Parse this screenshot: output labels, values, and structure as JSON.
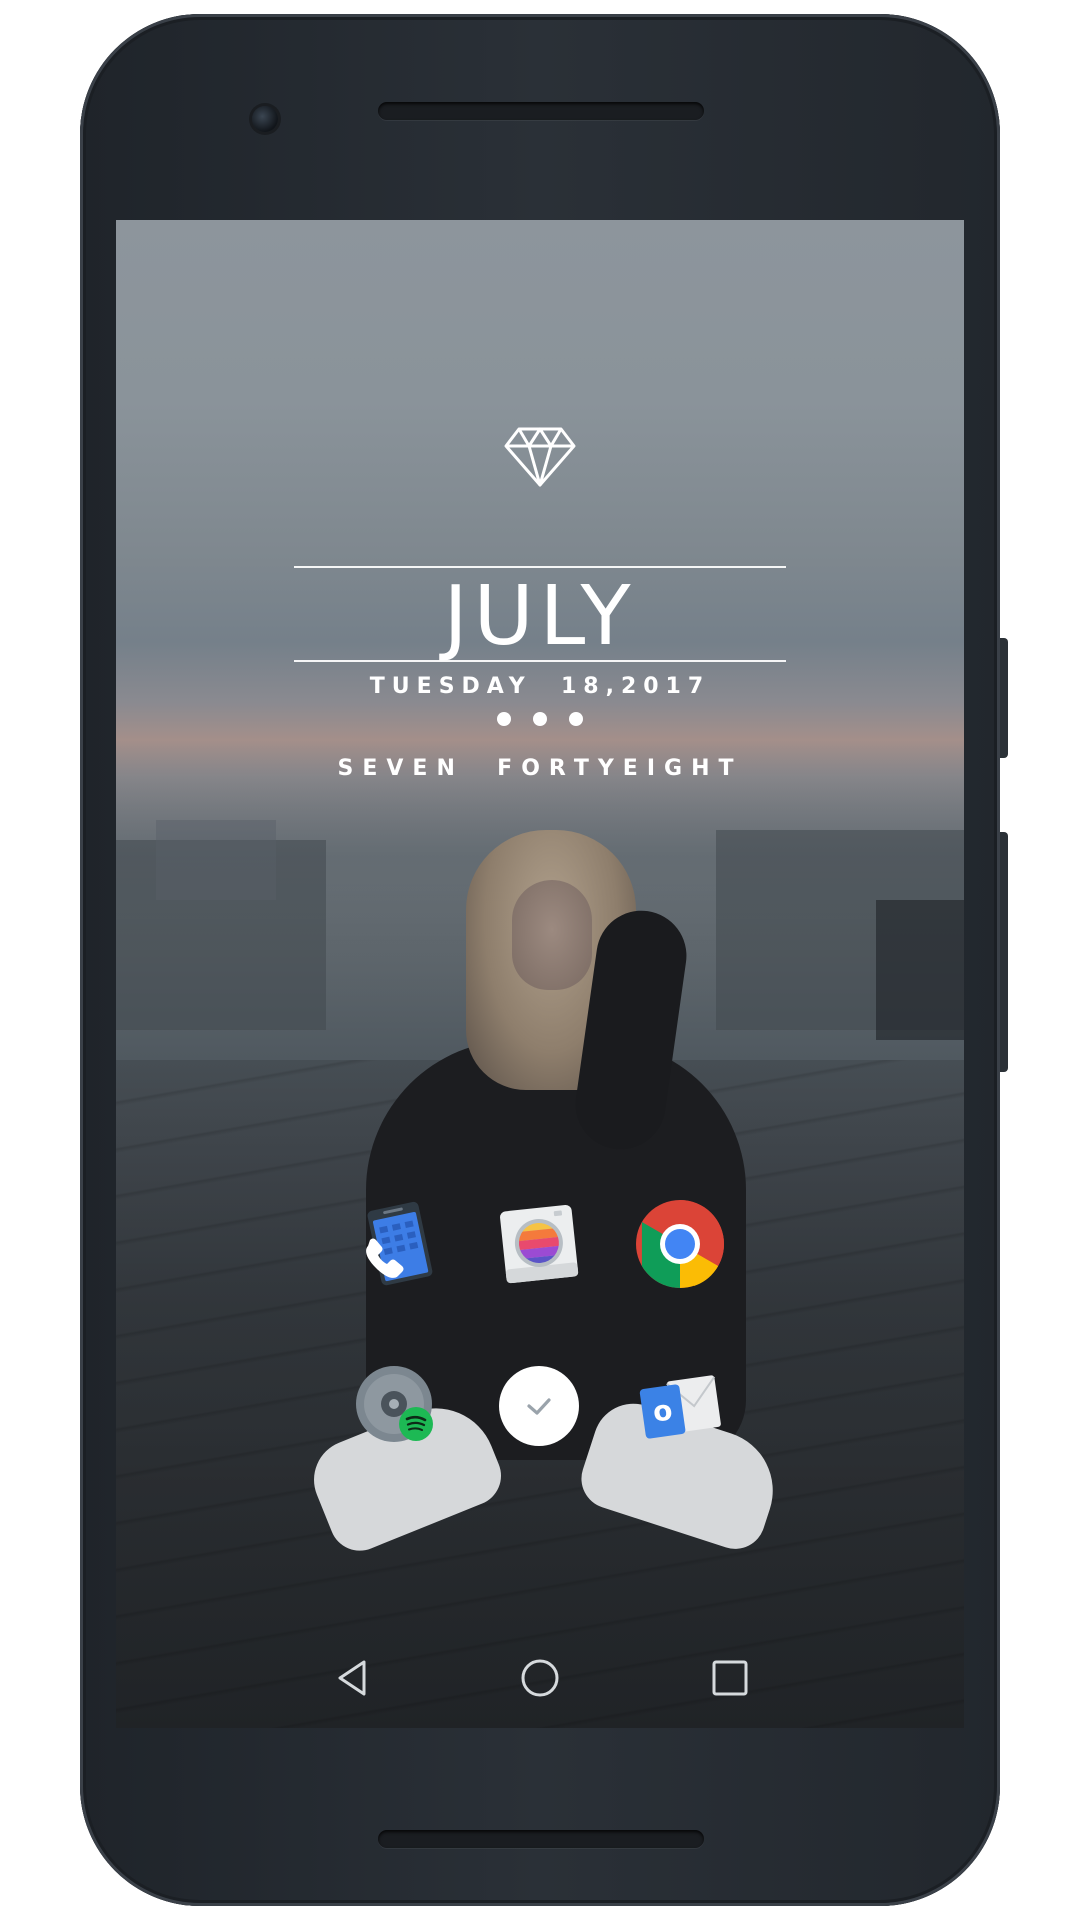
{
  "device": {
    "frame": "android-phone",
    "screen_colors": {
      "sky": "#8d959c",
      "roof": "#2b2f33"
    }
  },
  "widget": {
    "icon": "diamond-icon",
    "month": "JULY",
    "date_line": "TUESDAY  18,2017",
    "time_line": "SEVEN  FORTYEIGHT",
    "text_color": "#ffffff"
  },
  "apps": [
    {
      "name": "phone-dialer",
      "icon": "phone-dialer-icon"
    },
    {
      "name": "camera",
      "icon": "camera-icon"
    },
    {
      "name": "chrome",
      "icon": "chrome-icon"
    },
    {
      "name": "spotify-music",
      "icon": "spotify-music-icon"
    },
    {
      "name": "checkmark-app",
      "icon": "check-icon"
    },
    {
      "name": "outlook",
      "icon": "outlook-icon",
      "letter": "o"
    }
  ],
  "navbar": {
    "buttons": [
      "back-icon",
      "home-icon",
      "recents-icon"
    ]
  }
}
